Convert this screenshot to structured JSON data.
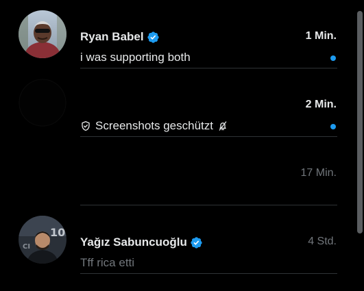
{
  "conversations": [
    {
      "name": "Ryan Babel",
      "verified": true,
      "time": "1 Min.",
      "preview": "i was supporting both",
      "unread": true,
      "avatar": "ryan-babel-photo"
    },
    {
      "name": "",
      "verified": false,
      "time": "2 Min.",
      "preview": "Screenshots geschützt",
      "preview_icon_before": "shield-icon",
      "preview_icon_after": "bell-off-icon",
      "unread": true,
      "avatar": "dark-avatar"
    },
    {
      "name": "",
      "verified": false,
      "time": "17 Min.",
      "preview": "",
      "unread": false,
      "avatar": "none"
    },
    {
      "name": "Yağız Sabuncuoğlu",
      "verified": true,
      "time": "4 Std.",
      "preview": "Tff rica etti",
      "unread": false,
      "avatar": "yagiz-photo"
    }
  ],
  "colors": {
    "background": "#000000",
    "primary_text": "#e7e9ea",
    "secondary_text": "#71767b",
    "accent": "#1d9bf0",
    "divider": "#2f3336"
  }
}
